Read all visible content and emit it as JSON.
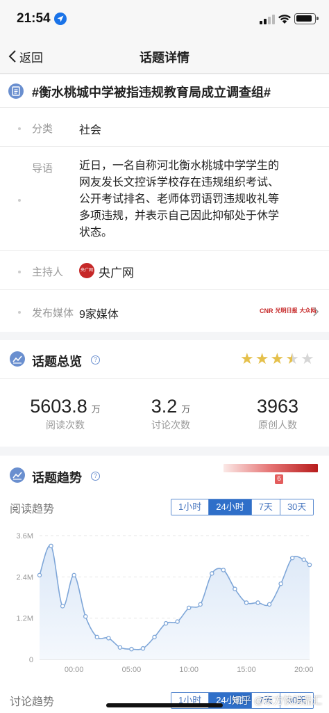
{
  "status_bar": {
    "time": "21:54"
  },
  "nav": {
    "back_label": "返回",
    "title": "话题详情"
  },
  "topic": {
    "title": "#衡水桃城中学被指违规教育局成立调查组#",
    "category_label": "分类",
    "category_value": "社会",
    "summary_label": "导语",
    "summary_lines": [
      "近日，一名自称河北衡水桃城中学学生的",
      "网友发长文控诉学校存在违规组织考试、",
      "公开考试排名、老师体罚语罚违规收礼等",
      "多项违规，并表示自己因此抑郁处于休学",
      "状态。"
    ],
    "host_label": "主持人",
    "host_logo_text": "央广网",
    "host_name": "央广网",
    "media_label": "发布媒体",
    "media_value": "9家媒体",
    "media_logos": [
      "CNR",
      "光明日报",
      "大众网"
    ]
  },
  "overview": {
    "title": "话题总览",
    "rating": 3.5,
    "rating_max": 5,
    "stats": [
      {
        "value": "5603.8",
        "unit": "万",
        "label": "阅读次数"
      },
      {
        "value": "3.2",
        "unit": "万",
        "label": "讨论次数"
      },
      {
        "value": "3963",
        "unit": "",
        "label": "原创人数"
      }
    ]
  },
  "trend": {
    "title": "话题趋势",
    "heat_level": "6",
    "read_label": "阅读趋势",
    "discuss_label": "讨论趋势",
    "tabs": [
      "1小时",
      "24小时",
      "7天",
      "30天"
    ],
    "active_tab": "24小时"
  },
  "watermark": "知乎 @东方快消品汇",
  "colors": {
    "accent": "#2f6fc9",
    "line": "#7ea6d8",
    "heat": "#b71c1c",
    "star": "#e5c04b"
  },
  "chart_data": {
    "type": "area",
    "title": "",
    "xlabel": "",
    "ylabel": "",
    "x_ticks": [
      "00:00",
      "05:00",
      "10:00",
      "15:00",
      "20:00"
    ],
    "y_ticks": [
      "0",
      "1.2M",
      "2.4M",
      "3.6M"
    ],
    "ylim": [
      0,
      3.6
    ],
    "y_unit": "M",
    "grid": true,
    "x": [
      -3,
      -2,
      -1,
      0,
      1,
      2,
      3,
      4,
      5,
      6,
      7,
      8,
      9,
      10,
      11,
      12,
      13,
      14,
      15,
      16,
      17,
      18,
      19,
      20,
      20.5
    ],
    "series": [
      {
        "values": [
          2.45,
          3.3,
          1.55,
          2.45,
          1.25,
          0.65,
          0.62,
          0.35,
          0.3,
          0.32,
          0.65,
          1.05,
          1.1,
          1.5,
          1.6,
          2.5,
          2.6,
          2.05,
          1.65,
          1.65,
          1.6,
          2.2,
          2.95,
          2.9,
          2.75
        ]
      }
    ]
  }
}
